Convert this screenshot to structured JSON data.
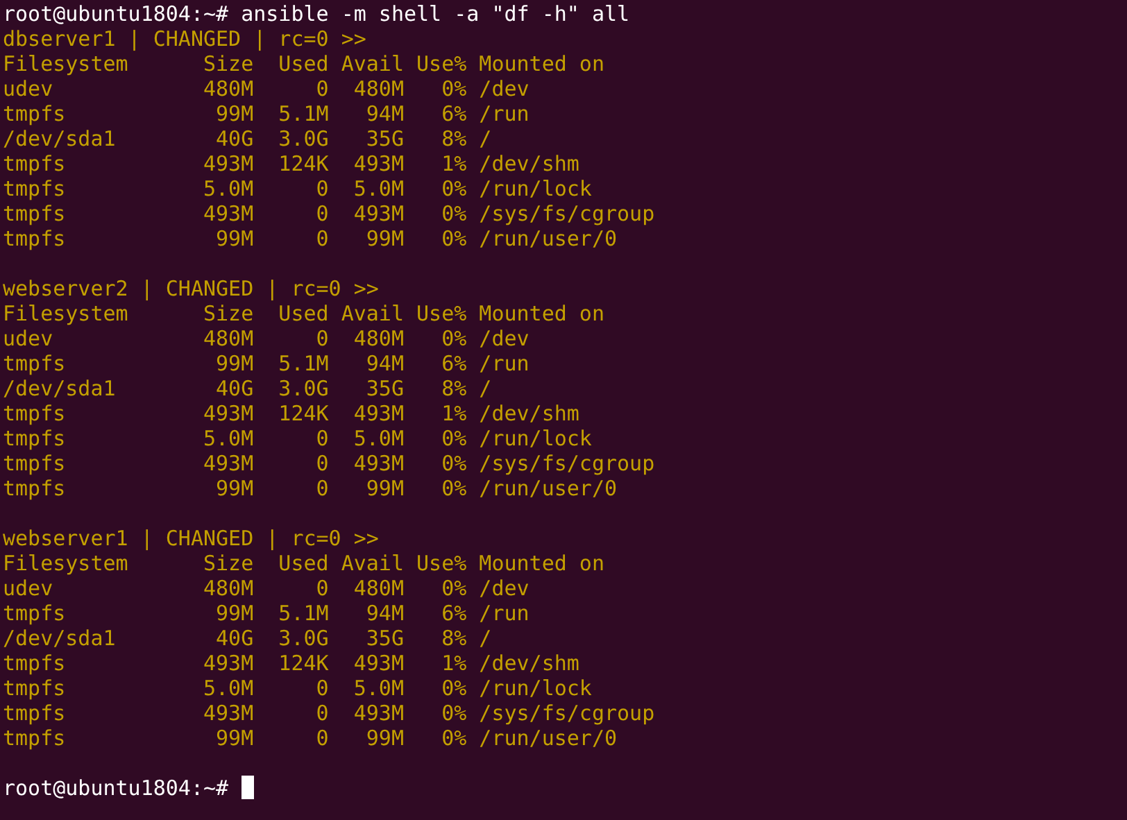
{
  "prompt": "root@ubuntu1804:~#",
  "command": "ansible -m shell -a \"df -h\" all",
  "blocks": [
    {
      "header": "dbserver1 | CHANGED | rc=0 >>",
      "lines": [
        "Filesystem      Size  Used Avail Use% Mounted on",
        "udev            480M     0  480M   0% /dev",
        "tmpfs            99M  5.1M   94M   6% /run",
        "/dev/sda1        40G  3.0G   35G   8% /",
        "tmpfs           493M  124K  493M   1% /dev/shm",
        "tmpfs           5.0M     0  5.0M   0% /run/lock",
        "tmpfs           493M     0  493M   0% /sys/fs/cgroup",
        "tmpfs            99M     0   99M   0% /run/user/0"
      ]
    },
    {
      "header": "webserver2 | CHANGED | rc=0 >>",
      "lines": [
        "Filesystem      Size  Used Avail Use% Mounted on",
        "udev            480M     0  480M   0% /dev",
        "tmpfs            99M  5.1M   94M   6% /run",
        "/dev/sda1        40G  3.0G   35G   8% /",
        "tmpfs           493M  124K  493M   1% /dev/shm",
        "tmpfs           5.0M     0  5.0M   0% /run/lock",
        "tmpfs           493M     0  493M   0% /sys/fs/cgroup",
        "tmpfs            99M     0   99M   0% /run/user/0"
      ]
    },
    {
      "header": "webserver1 | CHANGED | rc=0 >>",
      "lines": [
        "Filesystem      Size  Used Avail Use% Mounted on",
        "udev            480M     0  480M   0% /dev",
        "tmpfs            99M  5.1M   94M   6% /run",
        "/dev/sda1        40G  3.0G   35G   8% /",
        "tmpfs           493M  124K  493M   1% /dev/shm",
        "tmpfs           5.0M     0  5.0M   0% /run/lock",
        "tmpfs           493M     0  493M   0% /sys/fs/cgroup",
        "tmpfs            99M     0   99M   0% /run/user/0"
      ]
    }
  ],
  "final_prompt": "root@ubuntu1804:~#"
}
